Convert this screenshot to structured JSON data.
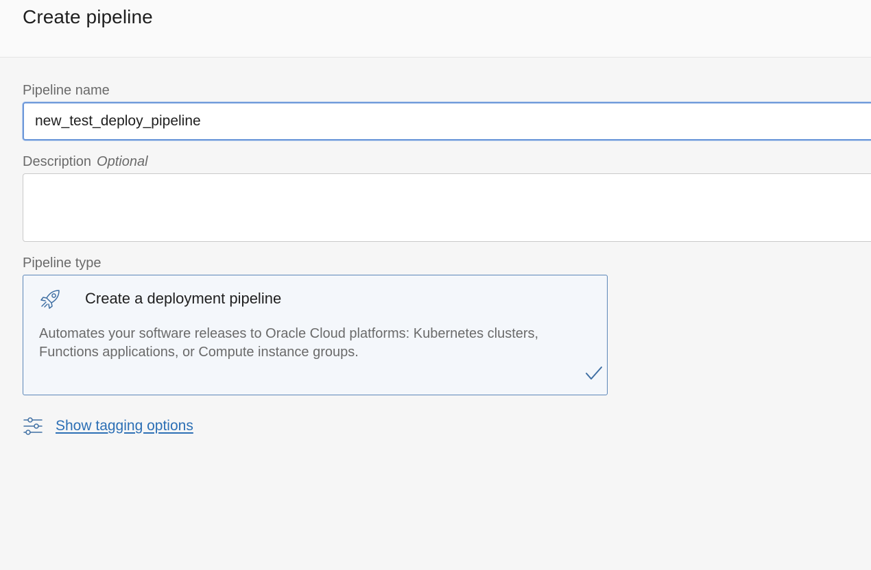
{
  "header": {
    "title": "Create pipeline"
  },
  "form": {
    "pipeline_name": {
      "label": "Pipeline name",
      "value": "new_test_deploy_pipeline"
    },
    "description": {
      "label": "Description",
      "optional_label": "Optional",
      "value": ""
    },
    "pipeline_type": {
      "label": "Pipeline type",
      "card": {
        "icon": "rocket-icon",
        "title": "Create a deployment pipeline",
        "description": "Automates your software releases to Oracle Cloud platforms: Kubernetes clusters, Functions applications, or Compute instance groups.",
        "selected": true,
        "check_icon": "checkmark-icon"
      }
    }
  },
  "tagging": {
    "icon": "sliders-icon",
    "link_label": "Show tagging options"
  },
  "colors": {
    "accent": "#2c6fb5",
    "card_border": "#5b86b8",
    "input_focus_border": "#6c98d9",
    "card_background": "#f4f7fb",
    "page_background": "#f6f6f6"
  }
}
